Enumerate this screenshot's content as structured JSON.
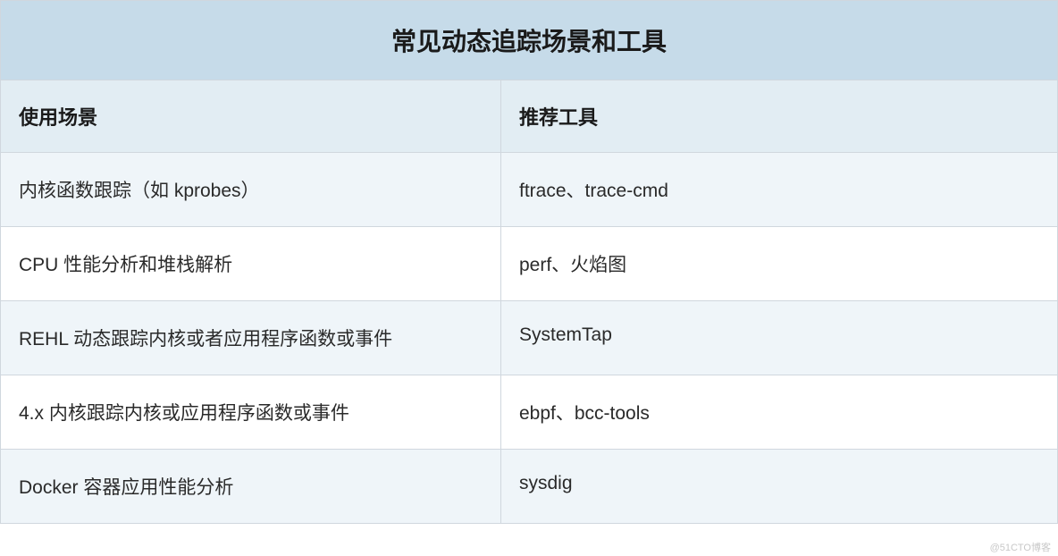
{
  "table": {
    "title": "常见动态追踪场景和工具",
    "headers": {
      "scenario": "使用场景",
      "tool": "推荐工具"
    },
    "rows": [
      {
        "scenario": "内核函数跟踪（如 kprobes）",
        "tool": "ftrace、trace-cmd"
      },
      {
        "scenario": "CPU 性能分析和堆栈解析",
        "tool": "perf、火焰图"
      },
      {
        "scenario": "REHL 动态跟踪内核或者应用程序函数或事件",
        "tool": "SystemTap"
      },
      {
        "scenario": "4.x 内核跟踪内核或应用程序函数或事件",
        "tool": "ebpf、bcc-tools"
      },
      {
        "scenario": "Docker 容器应用性能分析",
        "tool": "sysdig"
      }
    ]
  },
  "watermark": "@51CTO博客"
}
